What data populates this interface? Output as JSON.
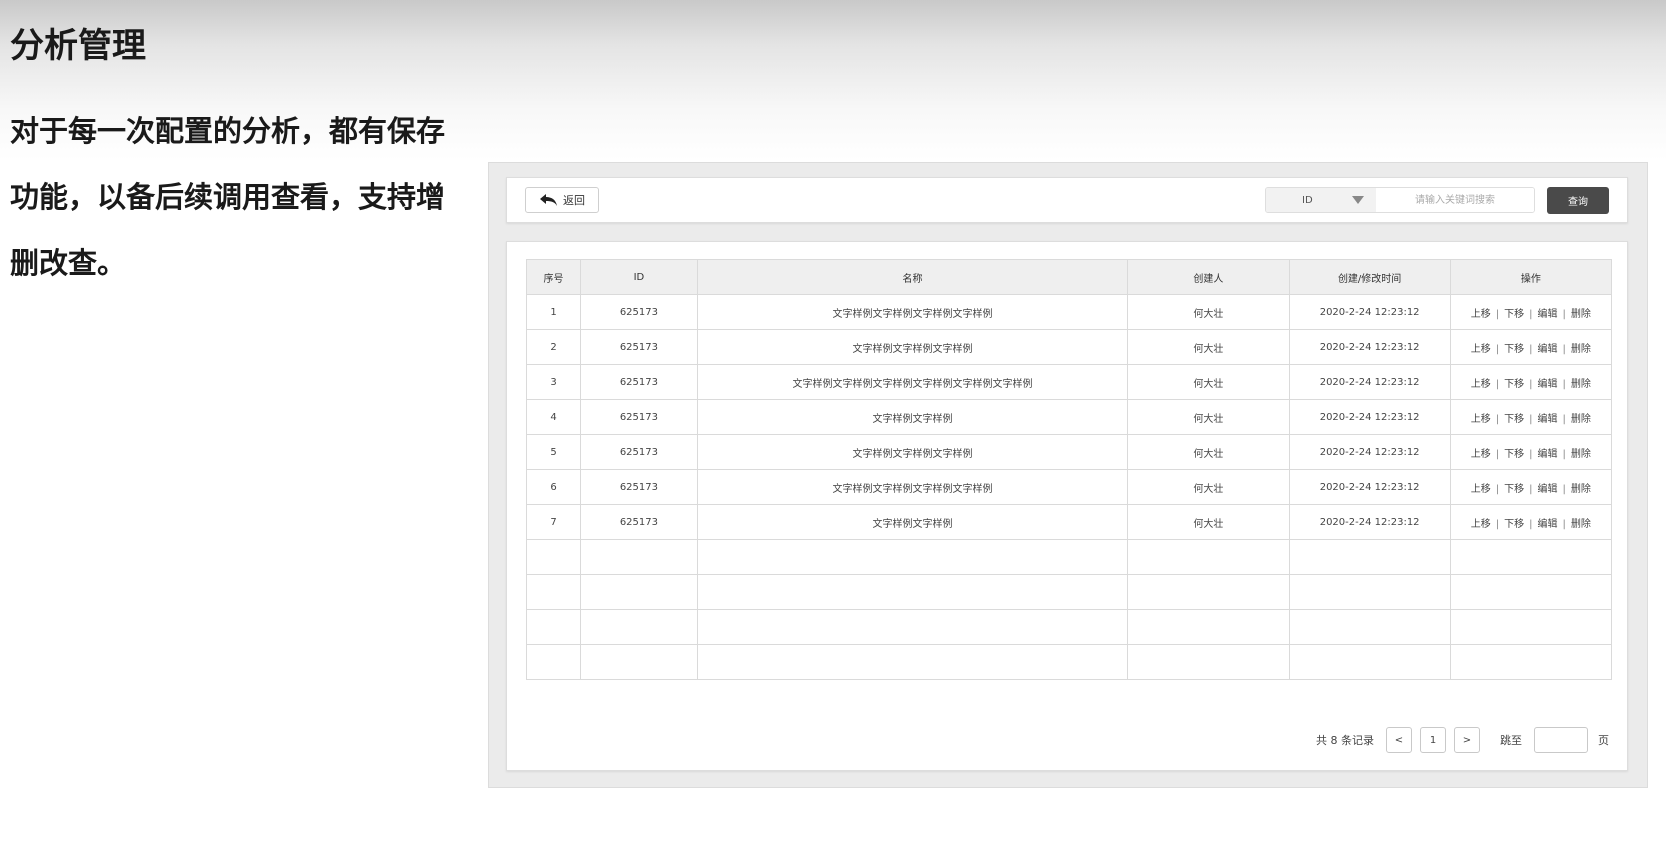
{
  "slide": {
    "title": "分析管理",
    "description": "对于每一次配置的分析，都有保存功能，以备后续调用查看，支持增删改查。"
  },
  "toolbar": {
    "back_label": "返回",
    "search_field_value": "ID",
    "search_placeholder": "请输入关键词搜索",
    "query_label": "查询"
  },
  "table": {
    "columns": [
      "序号",
      "ID",
      "名称",
      "创建人",
      "创建/修改时间",
      "操作"
    ],
    "actions": [
      "上移",
      "下移",
      "编辑",
      "删除"
    ],
    "rows": [
      {
        "no": "1",
        "id": "625173",
        "name": "文字样例文字样例文字样例文字样例",
        "creator": "何大壮",
        "time": "2020-2-24 12:23:12"
      },
      {
        "no": "2",
        "id": "625173",
        "name": "文字样例文字样例文字样例",
        "creator": "何大壮",
        "time": "2020-2-24 12:23:12"
      },
      {
        "no": "3",
        "id": "625173",
        "name": "文字样例文字样例文字样例文字样例文字样例文字样例",
        "creator": "何大壮",
        "time": "2020-2-24 12:23:12"
      },
      {
        "no": "4",
        "id": "625173",
        "name": "文字样例文字样例",
        "creator": "何大壮",
        "time": "2020-2-24 12:23:12"
      },
      {
        "no": "5",
        "id": "625173",
        "name": "文字样例文字样例文字样例",
        "creator": "何大壮",
        "time": "2020-2-24 12:23:12"
      },
      {
        "no": "6",
        "id": "625173",
        "name": "文字样例文字样例文字样例文字样例",
        "creator": "何大壮",
        "time": "2020-2-24 12:23:12"
      },
      {
        "no": "7",
        "id": "625173",
        "name": "文字样例文字样例",
        "creator": "何大壮",
        "time": "2020-2-24 12:23:12"
      }
    ],
    "empty_rows": 4
  },
  "pager": {
    "total_text": "共 8 条记录",
    "prev": "<",
    "current_page": "1",
    "next": ">",
    "jump_label": "跳至",
    "page_suffix": "页"
  }
}
